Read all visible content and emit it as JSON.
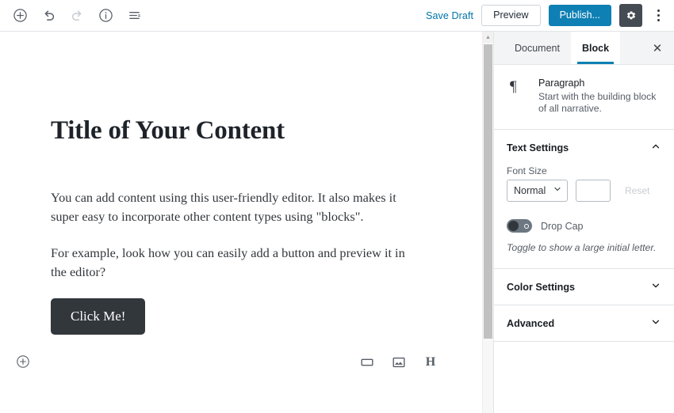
{
  "header": {
    "tools": [
      {
        "name": "add-block-icon",
        "label": "Add block"
      },
      {
        "name": "undo-icon",
        "label": "Undo"
      },
      {
        "name": "redo-icon",
        "label": "Redo"
      },
      {
        "name": "info-icon",
        "label": "Content structure"
      },
      {
        "name": "block-navigation-icon",
        "label": "Block navigation"
      }
    ],
    "save_draft_label": "Save Draft",
    "preview_label": "Preview",
    "publish_label": "Publish...",
    "settings_icon": "gear-icon",
    "more_menu_icon": "more-vertical-icon",
    "accent_blue": "#0e80b4",
    "link_blue": "#0073aa",
    "gear_bg": "#454b52"
  },
  "editor": {
    "title": "Title of Your Content",
    "paragraph_1": "You can add content using this user-friendly editor. It also makes it super easy to incorporate other content types using \"blocks\".",
    "paragraph_2": "For example, look how you can easily add a button and preview it in the editor?",
    "button_label": "Click Me!",
    "button_bg": "#32373c",
    "bottom_add_icon": "add-block-circle-icon",
    "quick_inserts": [
      {
        "name": "button-block-icon",
        "label": "Button"
      },
      {
        "name": "image-block-icon",
        "label": "Image"
      },
      {
        "name": "heading-block-icon",
        "label": "H"
      }
    ]
  },
  "sidebar": {
    "tabs": [
      {
        "label": "Document",
        "active": false
      },
      {
        "label": "Block",
        "active": true
      }
    ],
    "close_label": "✕",
    "block_card": {
      "icon": "paragraph-pilcrow-icon",
      "icon_glyph": "¶",
      "title": "Paragraph",
      "description": "Start with the building block of all narrative."
    },
    "text_settings": {
      "title": "Text Settings",
      "expanded": true,
      "font_size_label": "Font Size",
      "font_size_value": "Normal",
      "font_size_options": [
        "Normal"
      ],
      "custom_size_value": "",
      "custom_size_placeholder": "",
      "reset_label": "Reset",
      "drop_cap_label": "Drop Cap",
      "drop_cap_on": false,
      "drop_cap_help": "Toggle to show a large initial letter."
    },
    "color_settings": {
      "title": "Color Settings",
      "expanded": false
    },
    "advanced": {
      "title": "Advanced",
      "expanded": false
    },
    "active_tab_underline": "#0e80b4"
  }
}
